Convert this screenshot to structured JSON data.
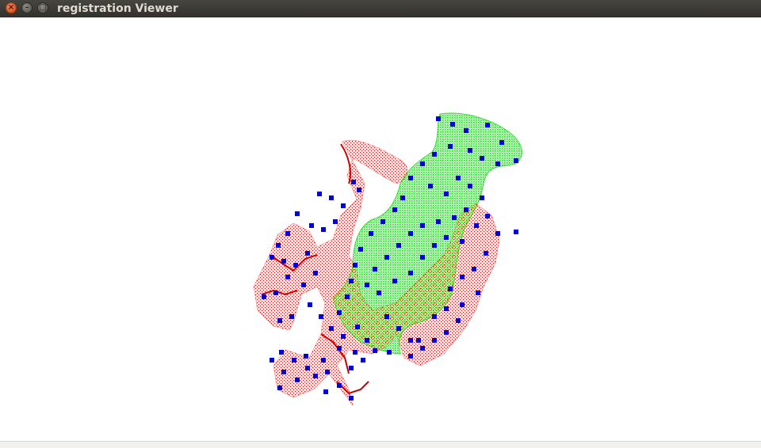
{
  "window": {
    "title": "registration Viewer",
    "buttons": {
      "close_glyph": "×",
      "minimize_glyph": "–",
      "maximize_glyph": "□"
    }
  },
  "viewer": {
    "background_color": "#ffffff",
    "source_cloud_color": "#dd0000",
    "target_cloud_color": "#00ee00",
    "keypoint_color": "#0000dd"
  }
}
